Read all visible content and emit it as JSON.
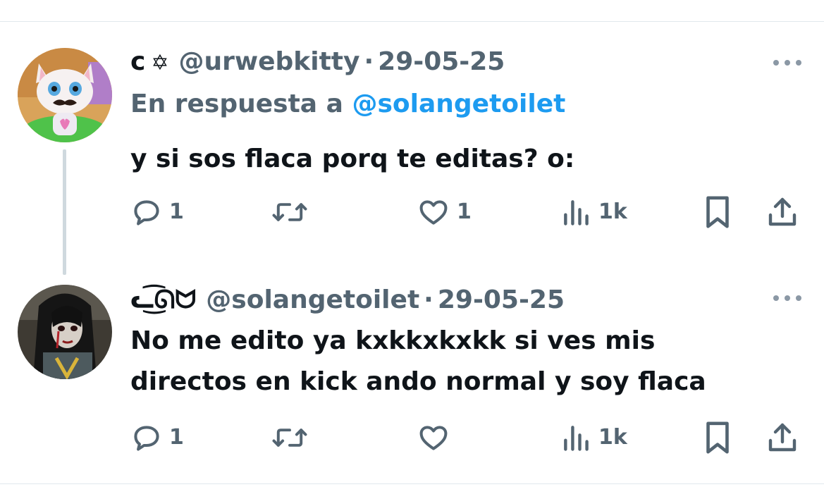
{
  "tweets": [
    {
      "name": "c",
      "name_glyph": "✡︎",
      "handle": "@urwebkitty",
      "separator": "·",
      "date": "29-05-25",
      "reply_prefix": "En respuesta a",
      "reply_mention": "@solangetoilet",
      "text": "y si sos flaca porq te editas? o:",
      "replies": "1",
      "retweets": "",
      "likes": "1",
      "views": "1k"
    },
    {
      "name": "ᓚ͜͡ᘏᗢ",
      "handle": "@solangetoilet",
      "separator": "·",
      "date": "29-05-25",
      "text_line1": "No me edito ya kxkkxkxkk si ves mis",
      "text_line2": "directos en kick ando normal y soy flaca",
      "replies": "1",
      "retweets": "",
      "likes": "",
      "views": "1k"
    }
  ],
  "colors": {
    "text": "#0f1419",
    "secondary": "#536471",
    "link": "#1d9bf0",
    "divider": "#e1e8ed",
    "thread_line": "#cfd9de"
  },
  "icons": [
    "reply-icon",
    "retweet-icon",
    "like-icon",
    "views-icon",
    "bookmark-icon",
    "share-icon",
    "more-icon"
  ]
}
